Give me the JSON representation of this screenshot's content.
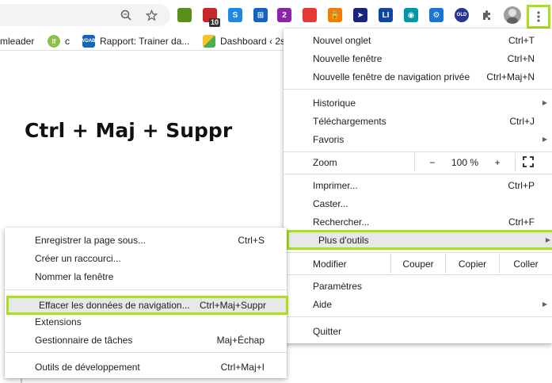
{
  "toolbar": {
    "zoom_icon": "zoom-icon",
    "star_icon": "star-icon",
    "extensions": [
      {
        "name": "eyedropper-extension-icon",
        "color": "#5a8f1c",
        "glyph": "",
        "badge": ""
      },
      {
        "name": "calendar-extension-icon",
        "color": "#c62828",
        "glyph": "",
        "badge": "10"
      },
      {
        "name": "skype-extension-icon",
        "color": "#1e88e5",
        "glyph": "S",
        "badge": ""
      },
      {
        "name": "grid-extension-icon",
        "color": "#1565c0",
        "glyph": "⊞",
        "badge": ""
      },
      {
        "name": "puzzle-2-extension-icon",
        "color": "#8e24aa",
        "glyph": "2",
        "badge": ""
      },
      {
        "name": "layers-extension-icon",
        "color": "#e53935",
        "glyph": "",
        "badge": ""
      },
      {
        "name": "lock-extension-icon",
        "color": "#f57c00",
        "glyph": "🔒",
        "badge": ""
      },
      {
        "name": "cursor-extension-icon",
        "color": "#1a237e",
        "glyph": "➤",
        "badge": ""
      },
      {
        "name": "linkedin-extension-icon",
        "color": "#0d47a1",
        "glyph": "LI",
        "badge": ""
      },
      {
        "name": "camera-extension-icon",
        "color": "#0097a7",
        "glyph": "◉",
        "badge": ""
      },
      {
        "name": "keyboard-extension-icon",
        "color": "#1976d2",
        "glyph": "⚙",
        "badge": ""
      },
      {
        "name": "old-extension-icon",
        "color": "#283593",
        "glyph": "OLD",
        "badge": ""
      }
    ],
    "puzzle_icon": "puzzle-icon",
    "avatar": "avatar",
    "menu_icon": "kebab-menu-icon",
    "accent": "#a8e01d"
  },
  "bookmarks": [
    {
      "label": "mleader",
      "icon_color": "",
      "icon_text": ""
    },
    {
      "label": "c",
      "icon_color": "#8bc34a",
      "icon_text": "lf"
    },
    {
      "label": "Rapport: Trainer da...",
      "icon_color": "#1565c0",
      "icon_text": "VDAB"
    },
    {
      "label": "Dashboard ‹ 2s",
      "icon_color": "#fbc02d",
      "icon_text": ""
    }
  ],
  "page": {
    "headline": "Ctrl + Maj + Suppr"
  },
  "main_menu": {
    "new_tab": {
      "label": "Nouvel onglet",
      "shortcut": "Ctrl+T"
    },
    "new_window": {
      "label": "Nouvelle fenêtre",
      "shortcut": "Ctrl+N"
    },
    "new_private": {
      "label": "Nouvelle fenêtre de navigation privée",
      "shortcut": "Ctrl+Maj+N"
    },
    "history": {
      "label": "Historique"
    },
    "downloads": {
      "label": "Téléchargements",
      "shortcut": "Ctrl+J"
    },
    "bookmarks": {
      "label": "Favoris"
    },
    "zoom": {
      "label": "Zoom",
      "minus": "−",
      "value": "100 %",
      "plus": "+"
    },
    "print": {
      "label": "Imprimer...",
      "shortcut": "Ctrl+P"
    },
    "cast": {
      "label": "Caster..."
    },
    "find": {
      "label": "Rechercher...",
      "shortcut": "Ctrl+F"
    },
    "more_tools": {
      "label": "Plus d'outils"
    },
    "edit": {
      "label": "Modifier",
      "cut": "Couper",
      "copy": "Copier",
      "paste": "Coller"
    },
    "settings": {
      "label": "Paramètres"
    },
    "help": {
      "label": "Aide"
    },
    "quit": {
      "label": "Quitter"
    }
  },
  "sub_menu": {
    "save_page": {
      "label": "Enregistrer la page sous...",
      "shortcut": "Ctrl+S"
    },
    "create_shortcut": {
      "label": "Créer un raccourci..."
    },
    "name_window": {
      "label": "Nommer la fenêtre"
    },
    "clear_data": {
      "label": "Effacer les données de navigation...",
      "shortcut": "Ctrl+Maj+Suppr"
    },
    "extensions": {
      "label": "Extensions"
    },
    "task_manager": {
      "label": "Gestionnaire de tâches",
      "shortcut": "Maj+Échap"
    },
    "dev_tools": {
      "label": "Outils de développement",
      "shortcut": "Ctrl+Maj+I"
    }
  }
}
